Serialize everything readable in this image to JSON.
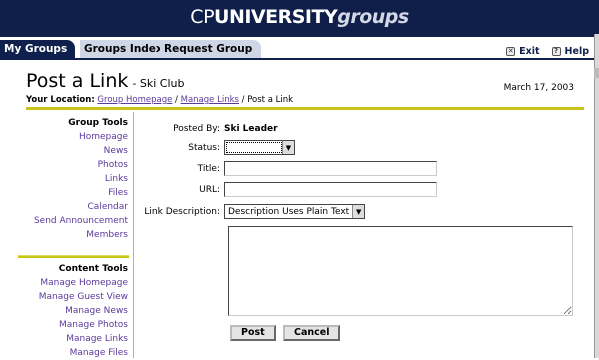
{
  "banner": {
    "cp": "CP",
    "university": "UNIVERSITY",
    "groups": "groups"
  },
  "tabs": [
    {
      "label": "My Groups",
      "active": true
    },
    {
      "label": "Groups Index",
      "active": false
    },
    {
      "label": "Request Group",
      "active": false
    }
  ],
  "top_links": {
    "exit": "Exit",
    "exit_icon": "x-box-icon",
    "help": "Help",
    "help_icon": "question-icon"
  },
  "header": {
    "title": "Post a Link",
    "club": "- Ski Club",
    "location_label": "Your Location:",
    "breadcrumb": [
      {
        "label": "Group Homepage",
        "link": true
      },
      {
        "label": "Manage Links",
        "link": true
      },
      {
        "label": "Post a Link",
        "link": false
      }
    ],
    "separator": "/",
    "date": "March 17, 2003"
  },
  "sidebar": {
    "group_tools_heading": "Group Tools",
    "group_tools": [
      "Homepage",
      "News",
      "Photos",
      "Links",
      "Files",
      "Calendar",
      "Send Announcement",
      "Members"
    ],
    "content_tools_heading": "Content Tools",
    "content_tools": [
      "Manage Homepage",
      "Manage Guest View",
      "Manage News",
      "Manage Photos",
      "Manage Links",
      "Manage Files"
    ]
  },
  "form": {
    "posted_by_label": "Posted By:",
    "posted_by_value": "Ski Leader",
    "status_label": "Status:",
    "status_value": "",
    "title_label": "Title:",
    "title_value": "",
    "url_label": "URL:",
    "url_value": "",
    "description_label": "Link Description:",
    "description_format": "Description Uses Plain Text",
    "description_value": "",
    "post_button": "Post",
    "cancel_button": "Cancel"
  },
  "colors": {
    "banner": "#0f1f4a",
    "accent_rule": "#c8c41a",
    "link": "#5a3a9c"
  }
}
